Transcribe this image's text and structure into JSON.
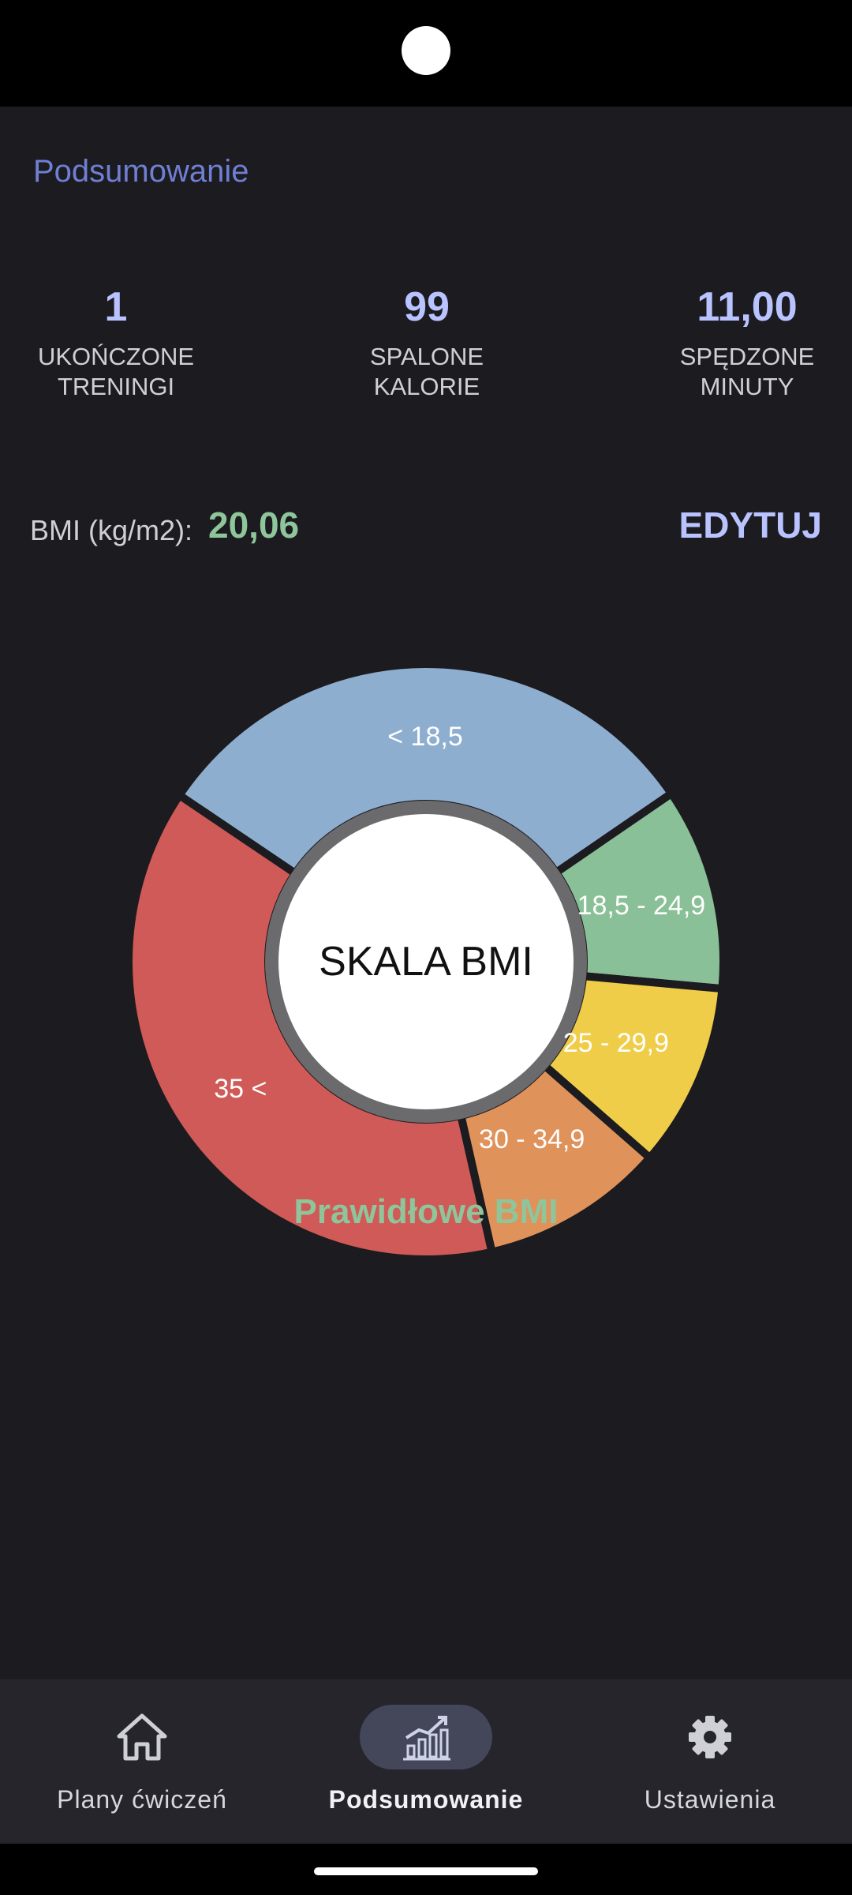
{
  "page": {
    "title": "Podsumowanie"
  },
  "stats": [
    {
      "value": "1",
      "label": "UKOŃCZONE\nTRENINGI"
    },
    {
      "value": "99",
      "label": "SPALONE\nKALORIE"
    },
    {
      "value": "11,00",
      "label": "SPĘDZONE\nMINUTY"
    }
  ],
  "bmi": {
    "label": "BMI (kg/m2):",
    "value": "20,06",
    "edit_label": "EDYTUJ",
    "status": "Prawidłowe BMI"
  },
  "chart_data": {
    "type": "pie",
    "title": "SKALA BMI",
    "categories": [
      "< 18,5",
      "18,5 - 24,9",
      "25 - 29,9",
      "30 - 34,9",
      "35 <"
    ],
    "values": [
      31,
      11,
      10,
      10,
      38
    ],
    "colors": [
      "#8eaed0",
      "#8ac097",
      "#f0cd49",
      "#e0925b",
      "#cf5a57"
    ],
    "start_angle_deg": -56
  },
  "nav": {
    "items": [
      {
        "label": "Plany ćwiczeń",
        "icon": "home-icon",
        "active": false
      },
      {
        "label": "Podsumowanie",
        "icon": "chart-trend-icon",
        "active": true
      },
      {
        "label": "Ustawienia",
        "icon": "gear-icon",
        "active": false
      }
    ]
  },
  "colors": {
    "background": "#1c1b1f",
    "accent": "#b8c3ff",
    "positive": "#8ec59a",
    "nav_background": "#26252c"
  }
}
